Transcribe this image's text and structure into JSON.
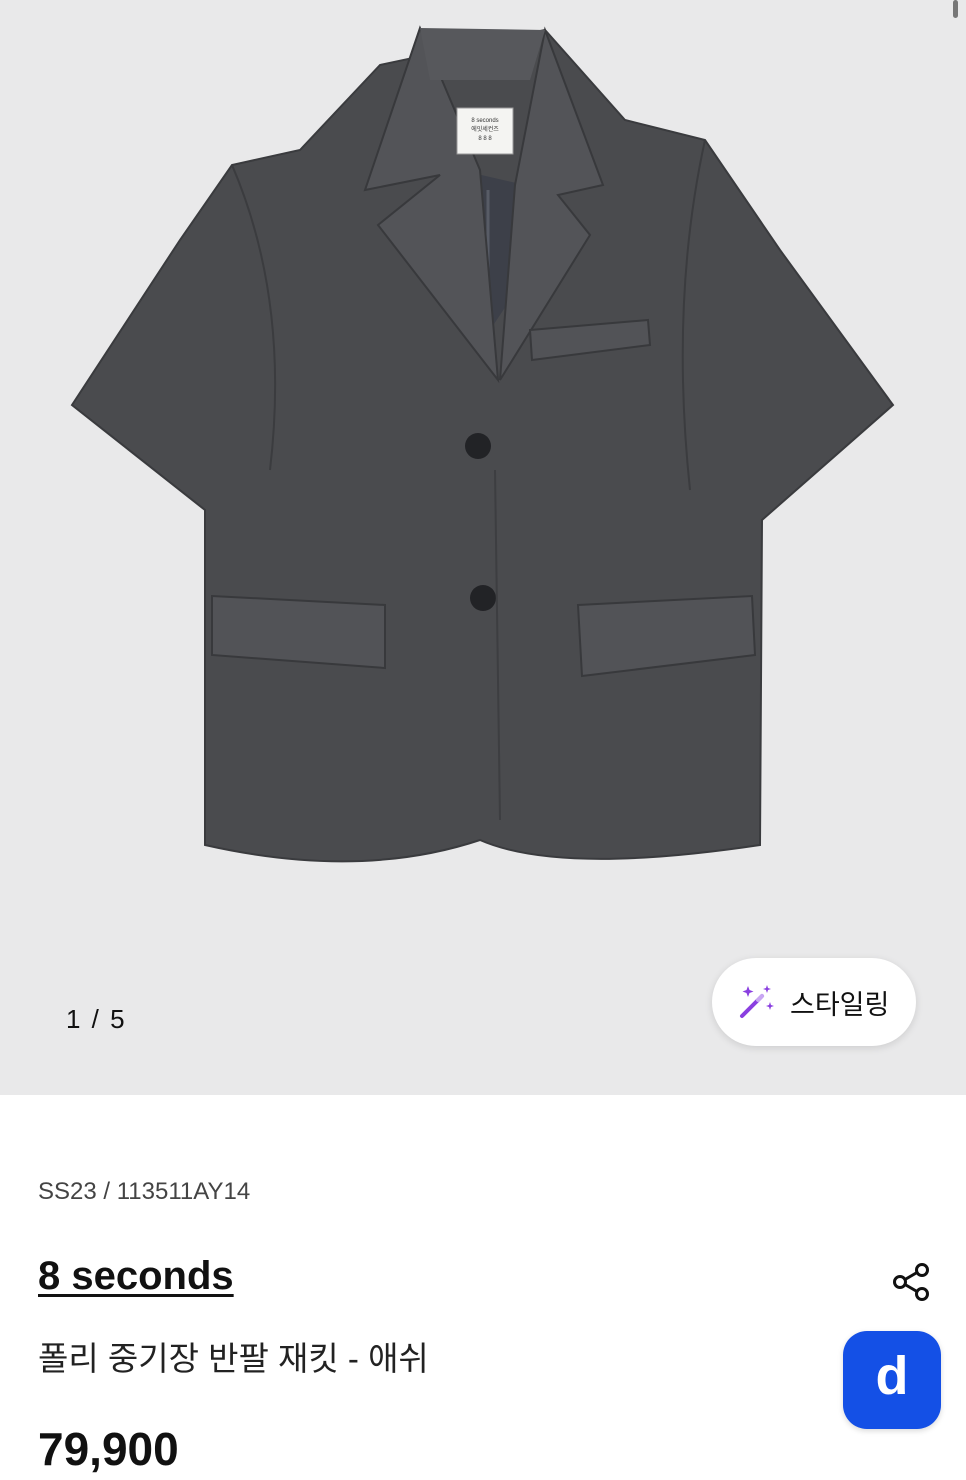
{
  "gallery": {
    "counter": "1 / 5",
    "tag_lines": [
      "8 seconds",
      "에잇세컨즈",
      "8 8 8"
    ],
    "styling_button_label": "스타일링"
  },
  "product": {
    "meta": "SS23 / 113511AY14",
    "brand": "8 seconds",
    "name": "폴리 중기장 반팔 재킷 - 애쉬",
    "price": "79,900"
  },
  "floating": {
    "app_badge_label": "d"
  },
  "colors": {
    "hero_bg": "#e9e9ea",
    "jacket": "#4a4b4e",
    "accent": "#1450e6",
    "wand": "#8a3fe0"
  },
  "icons": {
    "styling": "magic-wand-icon",
    "share": "share-icon"
  }
}
